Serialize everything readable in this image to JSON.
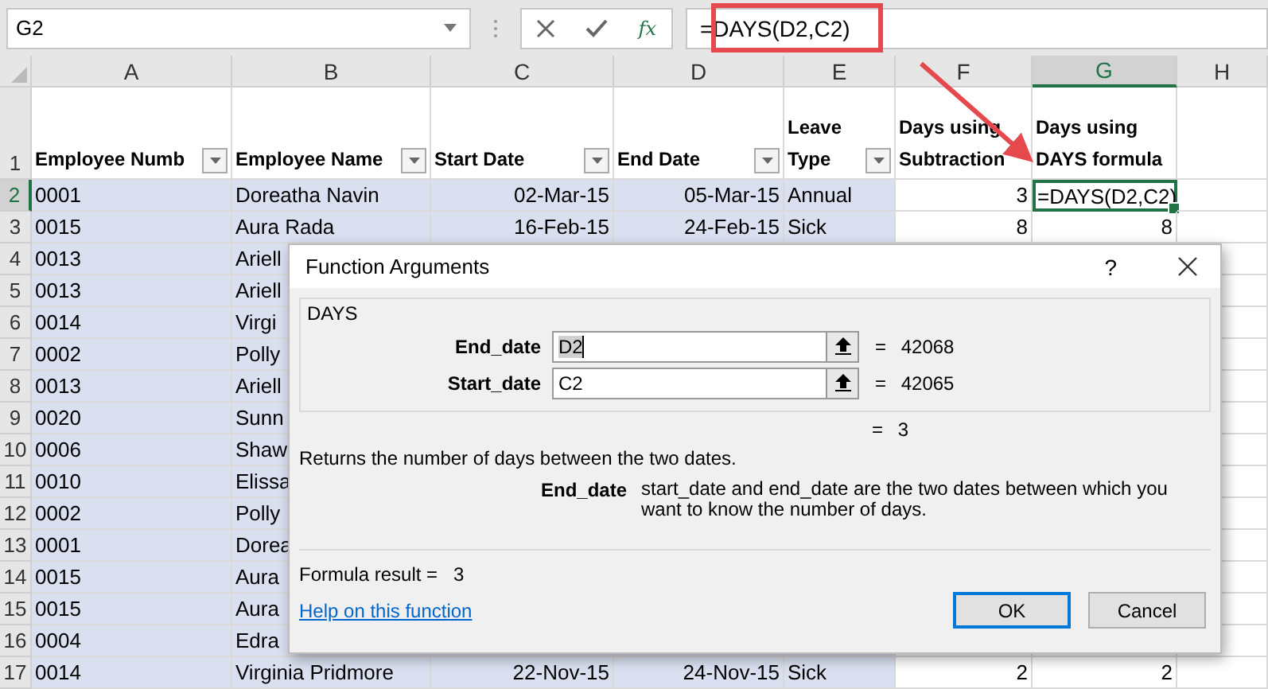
{
  "name_box": "G2",
  "formula_bar": {
    "fx": "fx",
    "formula": "=DAYS(D2,C2)",
    "highlighted": true
  },
  "columns": [
    {
      "label": "A",
      "selected": false
    },
    {
      "label": "B",
      "selected": false
    },
    {
      "label": "C",
      "selected": false
    },
    {
      "label": "D",
      "selected": false
    },
    {
      "label": "E",
      "selected": false
    },
    {
      "label": "F",
      "selected": false
    },
    {
      "label": "G",
      "selected": true
    },
    {
      "label": "H",
      "selected": false
    }
  ],
  "header_row": {
    "number": "1",
    "cells": [
      {
        "text": "Employee Numb",
        "filter": true
      },
      {
        "text": "Employee Name",
        "filter": true
      },
      {
        "text": "Start Date",
        "filter": true
      },
      {
        "text": "End Date",
        "filter": true
      },
      {
        "text": "Leave Type",
        "filter": true
      },
      {
        "text": "Days using Subtraction",
        "filter": false
      },
      {
        "text": "Days using DAYS formula",
        "filter": false
      }
    ]
  },
  "rows": [
    {
      "number": "2",
      "selected": true,
      "cells": [
        "0001",
        "Doreatha Navin",
        "02-Mar-15",
        "05-Mar-15",
        "Annual",
        "3",
        "=DAYS(D2,C2)"
      ]
    },
    {
      "number": "3",
      "selected": false,
      "cells": [
        "0015",
        "Aura Rada",
        "16-Feb-15",
        "24-Feb-15",
        "Sick",
        "8",
        "8"
      ]
    },
    {
      "number": "4",
      "selected": false,
      "cells": [
        "0013",
        "Ariell"
      ]
    },
    {
      "number": "5",
      "selected": false,
      "cells": [
        "0013",
        "Ariell"
      ]
    },
    {
      "number": "6",
      "selected": false,
      "cells": [
        "0014",
        "Virgi"
      ]
    },
    {
      "number": "7",
      "selected": false,
      "cells": [
        "0002",
        "Polly"
      ]
    },
    {
      "number": "8",
      "selected": false,
      "cells": [
        "0013",
        "Ariell"
      ]
    },
    {
      "number": "9",
      "selected": false,
      "cells": [
        "0020",
        "Sunn"
      ]
    },
    {
      "number": "10",
      "selected": false,
      "cells": [
        "0006",
        "Shaw"
      ]
    },
    {
      "number": "11",
      "selected": false,
      "cells": [
        "0010",
        "Elissa"
      ]
    },
    {
      "number": "12",
      "selected": false,
      "cells": [
        "0002",
        "Polly"
      ]
    },
    {
      "number": "13",
      "selected": false,
      "cells": [
        "0001",
        "Dorea"
      ]
    },
    {
      "number": "14",
      "selected": false,
      "cells": [
        "0015",
        "Aura"
      ]
    },
    {
      "number": "15",
      "selected": false,
      "cells": [
        "0015",
        "Aura"
      ]
    },
    {
      "number": "16",
      "selected": false,
      "cells": [
        "0004",
        "Edra"
      ]
    },
    {
      "number": "17",
      "selected": false,
      "cells": [
        "0014",
        "Virginia Pridmore",
        "22-Nov-15",
        "24-Nov-15",
        "Sick",
        "2",
        "2"
      ]
    }
  ],
  "dialog": {
    "title": "Function Arguments",
    "help": "?",
    "group": "DAYS",
    "arguments": [
      {
        "label": "End_date",
        "value": "D2",
        "result": "= 42068"
      },
      {
        "label": "Start_date",
        "value": "C2",
        "result": "= 42065"
      }
    ],
    "total": "= 3",
    "description": "Returns the number of days between the two dates.",
    "argument_help": {
      "name": "End_date",
      "text": "start_date and end_date are the two dates between which you want to know the number of days."
    },
    "formula_result": "Formula result =   3",
    "help_link": "Help on this function",
    "buttons": [
      {
        "label": "OK",
        "kind": "default"
      },
      {
        "label": "Cancel",
        "kind": "normal"
      }
    ]
  }
}
